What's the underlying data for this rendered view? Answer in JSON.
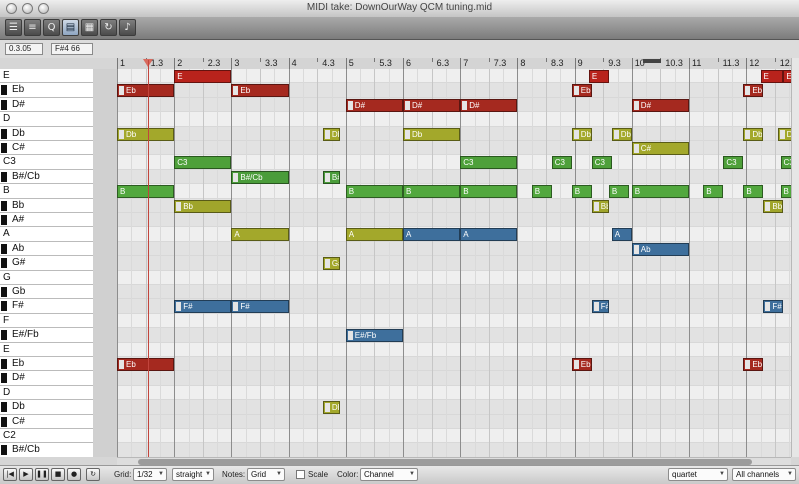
{
  "window": {
    "title": "MIDI take: DownOurWay QCM tuning.mid"
  },
  "toolbar": {
    "buttons": [
      {
        "name": "note-list-icon",
        "glyph": "☰",
        "on": false
      },
      {
        "name": "event-list-icon",
        "glyph": "≡",
        "on": false
      },
      {
        "name": "quantize-icon",
        "glyph": "Q",
        "on": false
      },
      {
        "name": "piano-roll-icon",
        "glyph": "▤",
        "on": true
      },
      {
        "name": "keyboard-icon",
        "glyph": "▦",
        "on": false
      },
      {
        "name": "loop-icon",
        "glyph": "↻",
        "on": false
      },
      {
        "name": "step-input-icon",
        "glyph": "♪",
        "on": false
      }
    ]
  },
  "position": {
    "time": "0.3.05",
    "note": "F#4 66"
  },
  "ruler": {
    "labels": [
      "1",
      "1.3",
      "2",
      "2.3",
      "3",
      "3.3",
      "4",
      "4.3",
      "5",
      "5.3",
      "6",
      "6.3",
      "7",
      "7.3",
      "8",
      "8.3",
      "9",
      "9.3",
      "10",
      "10.3",
      "11",
      "11.3",
      "12",
      "12.3"
    ]
  },
  "keys": [
    {
      "label": "E",
      "black": false
    },
    {
      "label": "Eb",
      "black": true
    },
    {
      "label": "D#",
      "black": true
    },
    {
      "label": "D",
      "black": false
    },
    {
      "label": "Db",
      "black": true
    },
    {
      "label": "C#",
      "black": true
    },
    {
      "label": "C3",
      "black": false
    },
    {
      "label": "B#/Cb",
      "black": true
    },
    {
      "label": "B",
      "black": false
    },
    {
      "label": "Bb",
      "black": true
    },
    {
      "label": "A#",
      "black": true
    },
    {
      "label": "A",
      "black": false
    },
    {
      "label": "Ab",
      "black": true
    },
    {
      "label": "G#",
      "black": true
    },
    {
      "label": "G",
      "black": false
    },
    {
      "label": "Gb",
      "black": true
    },
    {
      "label": "F#",
      "black": true
    },
    {
      "label": "F",
      "black": false
    },
    {
      "label": "E#/Fb",
      "black": true
    },
    {
      "label": "E",
      "black": false
    },
    {
      "label": "Eb",
      "black": true
    },
    {
      "label": "D#",
      "black": true
    },
    {
      "label": "D",
      "black": false
    },
    {
      "label": "Db",
      "black": true
    },
    {
      "label": "C#",
      "black": true
    },
    {
      "label": "C2",
      "black": false
    },
    {
      "label": "B#/Cb",
      "black": true
    }
  ],
  "notes": [
    {
      "row": 0,
      "start": 2,
      "end": 3,
      "label": "E"
    },
    {
      "row": 0,
      "start": 9.25,
      "end": 9.6,
      "label": "E"
    },
    {
      "row": 0,
      "start": 12.25,
      "end": 12.65,
      "label": "E"
    },
    {
      "row": 0,
      "start": 12.65,
      "end": 13,
      "label": "E"
    },
    {
      "row": 1,
      "start": 1,
      "end": 2,
      "label": "Eb"
    },
    {
      "row": 1,
      "start": 3,
      "end": 4,
      "label": "Eb"
    },
    {
      "row": 1,
      "start": 8.95,
      "end": 9.3,
      "label": "Eb"
    },
    {
      "row": 1,
      "start": 11.95,
      "end": 12.3,
      "label": "Eb"
    },
    {
      "row": 2,
      "start": 5,
      "end": 6,
      "label": "D#"
    },
    {
      "row": 2,
      "start": 6,
      "end": 7,
      "label": "D#"
    },
    {
      "row": 2,
      "start": 7,
      "end": 8,
      "label": "D#"
    },
    {
      "row": 2,
      "start": 10,
      "end": 11,
      "label": "D#"
    },
    {
      "row": 4,
      "start": 1,
      "end": 2,
      "label": "Db"
    },
    {
      "row": 4,
      "start": 4.6,
      "end": 4.9,
      "label": "Db"
    },
    {
      "row": 4,
      "start": 6,
      "end": 7,
      "label": "Db"
    },
    {
      "row": 4,
      "start": 8.95,
      "end": 9.3,
      "label": "Db"
    },
    {
      "row": 4,
      "start": 9.65,
      "end": 10,
      "label": "Db"
    },
    {
      "row": 4,
      "start": 11.95,
      "end": 12.3,
      "label": "Db"
    },
    {
      "row": 4,
      "start": 12.55,
      "end": 12.9,
      "label": "Db"
    },
    {
      "row": 5,
      "start": 10,
      "end": 11,
      "label": "C#"
    },
    {
      "row": 6,
      "start": 2,
      "end": 3,
      "label": "C3"
    },
    {
      "row": 6,
      "start": 7,
      "end": 8,
      "label": "C3"
    },
    {
      "row": 6,
      "start": 8.6,
      "end": 8.95,
      "label": "C3"
    },
    {
      "row": 6,
      "start": 9.3,
      "end": 9.65,
      "label": "C3"
    },
    {
      "row": 6,
      "start": 11.6,
      "end": 11.95,
      "label": "C3"
    },
    {
      "row": 6,
      "start": 12.6,
      "end": 12.95,
      "label": "C3"
    },
    {
      "row": 7,
      "start": 3,
      "end": 4,
      "label": "B#/Cb"
    },
    {
      "row": 7,
      "start": 4.6,
      "end": 4.9,
      "label": "B#/Cb"
    },
    {
      "row": 8,
      "start": 1,
      "end": 2,
      "label": "B"
    },
    {
      "row": 8,
      "start": 5,
      "end": 6,
      "label": "B"
    },
    {
      "row": 8,
      "start": 6,
      "end": 7,
      "label": "B"
    },
    {
      "row": 8,
      "start": 7,
      "end": 8,
      "label": "B"
    },
    {
      "row": 8,
      "start": 8.25,
      "end": 8.6,
      "label": "B"
    },
    {
      "row": 8,
      "start": 8.95,
      "end": 9.3,
      "label": "B"
    },
    {
      "row": 8,
      "start": 9.6,
      "end": 9.95,
      "label": "B"
    },
    {
      "row": 8,
      "start": 10,
      "end": 11,
      "label": "B"
    },
    {
      "row": 8,
      "start": 11.25,
      "end": 11.6,
      "label": "B"
    },
    {
      "row": 8,
      "start": 11.95,
      "end": 12.3,
      "label": "B"
    },
    {
      "row": 8,
      "start": 12.6,
      "end": 12.95,
      "label": "B"
    },
    {
      "row": 9,
      "start": 2,
      "end": 3,
      "label": "Bb"
    },
    {
      "row": 9,
      "start": 9.3,
      "end": 9.6,
      "label": "Bb"
    },
    {
      "row": 9,
      "start": 12.3,
      "end": 12.65,
      "label": "Bb"
    },
    {
      "row": 11,
      "start": 3,
      "end": 4,
      "label": "A"
    },
    {
      "row": 11,
      "start": 5,
      "end": 6,
      "label": "A"
    },
    {
      "row": 11,
      "start": 6,
      "end": 7,
      "label": "A"
    },
    {
      "row": 11,
      "start": 7,
      "end": 8,
      "label": "A"
    },
    {
      "row": 11,
      "start": 9.65,
      "end": 10,
      "label": "A"
    },
    {
      "row": 12,
      "start": 10,
      "end": 11,
      "label": "Ab"
    },
    {
      "row": 13,
      "start": 4.6,
      "end": 4.9,
      "label": "G#"
    },
    {
      "row": 16,
      "start": 2,
      "end": 3,
      "label": "F#"
    },
    {
      "row": 16,
      "start": 3,
      "end": 4,
      "label": "F#"
    },
    {
      "row": 16,
      "start": 9.3,
      "end": 9.6,
      "label": "F#"
    },
    {
      "row": 16,
      "start": 12.3,
      "end": 12.65,
      "label": "F#"
    },
    {
      "row": 18,
      "start": 5,
      "end": 6,
      "label": "E#/Fb"
    },
    {
      "row": 20,
      "start": 1,
      "end": 2,
      "label": "Eb"
    },
    {
      "row": 20,
      "start": 8.95,
      "end": 9.3,
      "label": "Eb"
    },
    {
      "row": 20,
      "start": 11.95,
      "end": 12.3,
      "label": "Eb"
    },
    {
      "row": 23,
      "start": 4.6,
      "end": 4.9,
      "label": "Db"
    }
  ],
  "colors": {
    "E": "#b8231c",
    "Eb": "#a5291f",
    "D#": "#a5291f",
    "Db": "#a3a82b",
    "C#": "#a3a82b",
    "C3": "#4ea03a",
    "B#/Cb": "#4a9c3a",
    "B": "#52a83e",
    "Bb": "#a0a52b",
    "A": "#a3a82b",
    "Ab": "#3e6f9c",
    "G#": "#a3a82b",
    "F#": "#3e6f9c",
    "E#/Fb": "#3e6f9c"
  },
  "note_colors": {
    "A": [
      {
        "start": 6,
        "color": "#3e6f9c"
      },
      {
        "start": 7,
        "color": "#3e6f9c"
      },
      {
        "start": 9.65,
        "color": "#3e6f9c"
      }
    ]
  },
  "bottom": {
    "transport": [
      "|◀",
      "▶",
      "❚❚",
      "■",
      "●",
      "↻"
    ],
    "grid_label": "Grid:",
    "grid_value": "1/32",
    "grid_mode": "straight",
    "notes_label": "Notes:",
    "notes_value": "Grid",
    "scale_label": "Scale",
    "color_label": "Color:",
    "color_value": "Channel",
    "tuning_value": "quartet",
    "channel_value": "All channels"
  }
}
